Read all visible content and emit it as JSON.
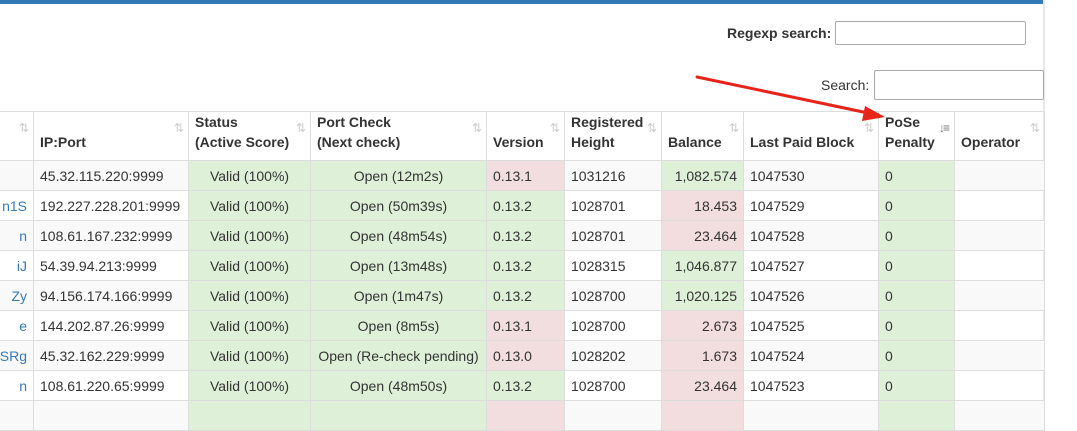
{
  "filters": {
    "regexp_label": "Regexp search:",
    "regexp_value": "",
    "search_label": "Search:",
    "search_value": ""
  },
  "columns": [
    {
      "line1": "",
      "line2": ""
    },
    {
      "line1": "",
      "line2": "IP:Port"
    },
    {
      "line1": "Status",
      "line2": "(Active Score)"
    },
    {
      "line1": "Port Check",
      "line2": "(Next check)"
    },
    {
      "line1": "",
      "line2": "Version"
    },
    {
      "line1": "Registered",
      "line2": "Height"
    },
    {
      "line1": "",
      "line2": "Balance"
    },
    {
      "line1": "",
      "line2": "Last Paid Block"
    },
    {
      "line1": "PoSe",
      "line2": "Penalty"
    },
    {
      "line1": "",
      "line2": "Operator"
    }
  ],
  "sort_icons": {
    "default": "⇅",
    "active_desc": "↓≡"
  },
  "rows": [
    {
      "address": "",
      "ip": "45.32.115.220:9999",
      "status": "Valid (100%)",
      "port": "Open (12m2s)",
      "version": "0.13.1",
      "version_state": "bad",
      "height": "1031216",
      "balance": "1,082.574",
      "balance_state": "ok",
      "last_paid": "1047530",
      "pose": "0",
      "operator": ""
    },
    {
      "address": "n1S",
      "ip": "192.227.228.201:9999",
      "status": "Valid (100%)",
      "port": "Open (50m39s)",
      "version": "0.13.2",
      "version_state": "ok",
      "height": "1028701",
      "balance": "18.453",
      "balance_state": "bad",
      "last_paid": "1047529",
      "pose": "0",
      "operator": ""
    },
    {
      "address": "n",
      "ip": "108.61.167.232:9999",
      "status": "Valid (100%)",
      "port": "Open (48m54s)",
      "version": "0.13.2",
      "version_state": "ok",
      "height": "1028701",
      "balance": "23.464",
      "balance_state": "bad",
      "last_paid": "1047528",
      "pose": "0",
      "operator": ""
    },
    {
      "address": "iJ",
      "ip": "54.39.94.213:9999",
      "status": "Valid (100%)",
      "port": "Open (13m48s)",
      "version": "0.13.2",
      "version_state": "ok",
      "height": "1028315",
      "balance": "1,046.877",
      "balance_state": "ok",
      "last_paid": "1047527",
      "pose": "0",
      "operator": ""
    },
    {
      "address": "Zy",
      "ip": "94.156.174.166:9999",
      "status": "Valid (100%)",
      "port": "Open (1m47s)",
      "version": "0.13.2",
      "version_state": "ok",
      "height": "1028700",
      "balance": "1,020.125",
      "balance_state": "ok",
      "last_paid": "1047526",
      "pose": "0",
      "operator": ""
    },
    {
      "address": "e",
      "ip": "144.202.87.26:9999",
      "status": "Valid (100%)",
      "port": "Open (8m5s)",
      "version": "0.13.1",
      "version_state": "bad",
      "height": "1028700",
      "balance": "2.673",
      "balance_state": "bad",
      "last_paid": "1047525",
      "pose": "0",
      "operator": ""
    },
    {
      "address": "SRg",
      "ip": "45.32.162.229:9999",
      "status": "Valid (100%)",
      "port": "Open (Re-check pending)",
      "version": "0.13.0",
      "version_state": "bad",
      "height": "1028202",
      "balance": "1.673",
      "balance_state": "bad",
      "last_paid": "1047524",
      "pose": "0",
      "operator": ""
    },
    {
      "address": "n",
      "ip": "108.61.220.65:9999",
      "status": "Valid (100%)",
      "port": "Open (48m50s)",
      "version": "0.13.2",
      "version_state": "ok",
      "height": "1028700",
      "balance": "23.464",
      "balance_state": "bad",
      "last_paid": "1047523",
      "pose": "0",
      "operator": ""
    },
    {
      "address": "",
      "ip": "",
      "status": "",
      "port": "",
      "version": "",
      "version_state": "bad",
      "height": "",
      "balance": "",
      "balance_state": "bad",
      "last_paid": "",
      "pose": "",
      "operator": ""
    }
  ],
  "annotation": {
    "color": "#e8231a"
  },
  "colors": {
    "accent": "#337ab7",
    "valid_bg": "#dff0d8",
    "invalid_bg": "#f2dede"
  }
}
